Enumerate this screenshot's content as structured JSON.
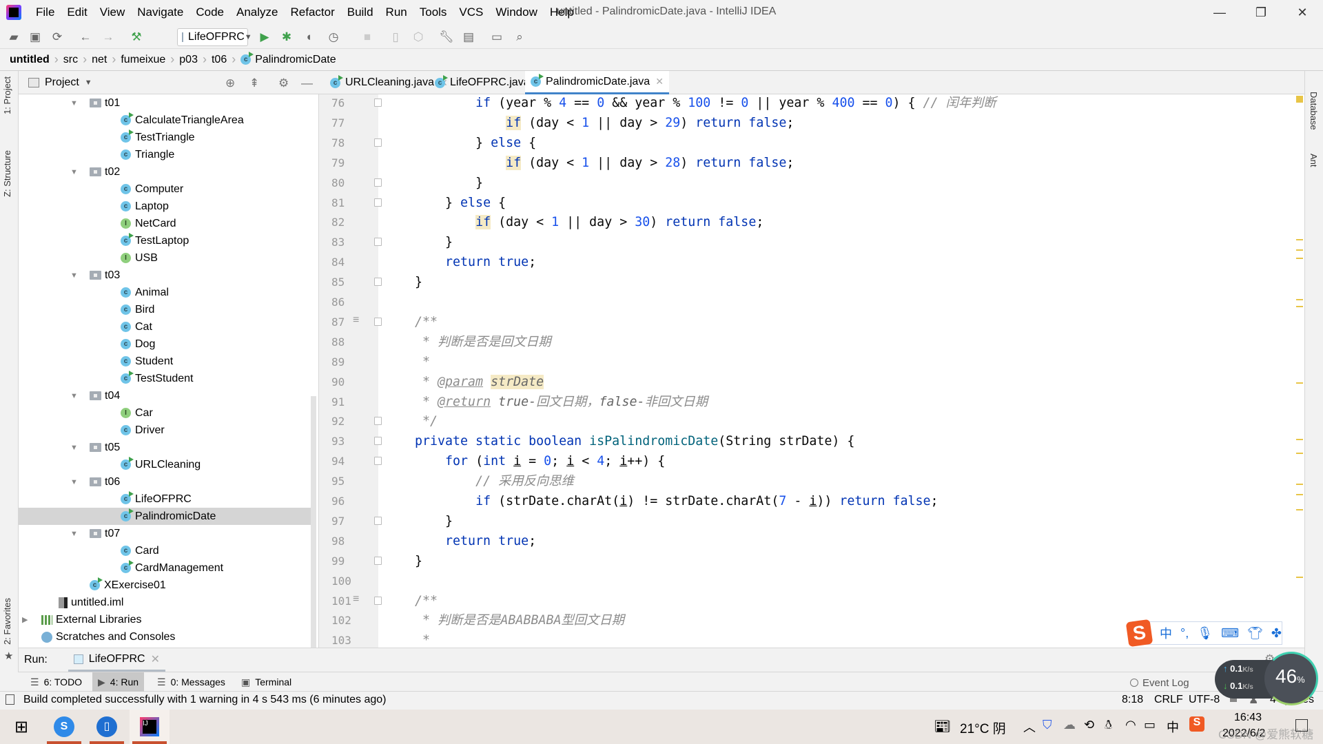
{
  "window": {
    "title": "untitled - PalindromicDate.java - IntelliJ IDEA",
    "minimize": "—",
    "restore": "❐",
    "close": "✕"
  },
  "menu": [
    "File",
    "Edit",
    "View",
    "Navigate",
    "Code",
    "Analyze",
    "Refactor",
    "Build",
    "Run",
    "Tools",
    "VCS",
    "Window",
    "Help"
  ],
  "toolbar": {
    "run_config": "LifeOFPRC",
    "icons": [
      "open-icon",
      "save-icon",
      "sync-icon",
      "back-icon",
      "forward-icon",
      "build-hammer-icon",
      "run-icon",
      "debug-icon",
      "coverage-icon",
      "profile-icon",
      "stop-icon",
      "device-icon",
      "sdk-icon",
      "settings-wrench-icon",
      "project-structure-icon",
      "terminal-icon",
      "search-icon"
    ]
  },
  "breadcrumb": [
    "untitled",
    "src",
    "net",
    "fumeixue",
    "p03",
    "t06",
    "PalindromicDate"
  ],
  "left_strip": {
    "project": "1: Project",
    "structure": "Z: Structure",
    "favorites": "2: Favorites"
  },
  "right_strip": {
    "database": "Database",
    "ant": "Ant"
  },
  "project_panel": {
    "title": "Project",
    "tree": [
      {
        "label": "t01",
        "type": "package",
        "level": 3,
        "expanded": true
      },
      {
        "label": "CalculateTriangleArea",
        "type": "class-run",
        "level": 4
      },
      {
        "label": "TestTriangle",
        "type": "class-run",
        "level": 4
      },
      {
        "label": "Triangle",
        "type": "class",
        "level": 4
      },
      {
        "label": "t02",
        "type": "package",
        "level": 3,
        "expanded": true
      },
      {
        "label": "Computer",
        "type": "class",
        "level": 4
      },
      {
        "label": "Laptop",
        "type": "class",
        "level": 4
      },
      {
        "label": "NetCard",
        "type": "interface",
        "level": 4
      },
      {
        "label": "TestLaptop",
        "type": "class-run",
        "level": 4
      },
      {
        "label": "USB",
        "type": "interface",
        "level": 4
      },
      {
        "label": "t03",
        "type": "package",
        "level": 3,
        "expanded": true
      },
      {
        "label": "Animal",
        "type": "class",
        "level": 4
      },
      {
        "label": "Bird",
        "type": "class",
        "level": 4
      },
      {
        "label": "Cat",
        "type": "class",
        "level": 4
      },
      {
        "label": "Dog",
        "type": "class",
        "level": 4
      },
      {
        "label": "Student",
        "type": "class",
        "level": 4
      },
      {
        "label": "TestStudent",
        "type": "class-run",
        "level": 4
      },
      {
        "label": "t04",
        "type": "package",
        "level": 3,
        "expanded": true
      },
      {
        "label": "Car",
        "type": "interface",
        "level": 4
      },
      {
        "label": "Driver",
        "type": "class",
        "level": 4
      },
      {
        "label": "t05",
        "type": "package",
        "level": 3,
        "expanded": true
      },
      {
        "label": "URLCleaning",
        "type": "class-run",
        "level": 4
      },
      {
        "label": "t06",
        "type": "package",
        "level": 3,
        "expanded": true
      },
      {
        "label": "LifeOFPRC",
        "type": "class-run",
        "level": 4
      },
      {
        "label": "PalindromicDate",
        "type": "class-run",
        "level": 4,
        "selected": true
      },
      {
        "label": "t07",
        "type": "package",
        "level": 3,
        "expanded": true
      },
      {
        "label": "Card",
        "type": "class",
        "level": 4
      },
      {
        "label": "CardManagement",
        "type": "class-run",
        "level": 4
      },
      {
        "label": "XExercise01",
        "type": "class-run",
        "level": 3
      },
      {
        "label": "untitled.iml",
        "type": "iml",
        "level": 2
      },
      {
        "label": "External Libraries",
        "type": "library",
        "level": 1,
        "expanded": false
      },
      {
        "label": "Scratches and Consoles",
        "type": "scratch",
        "level": 1
      }
    ]
  },
  "tabs": [
    {
      "label": "URLCleaning.java",
      "active": false
    },
    {
      "label": "LifeOFPRC.java",
      "active": false
    },
    {
      "label": "PalindromicDate.java",
      "active": true
    }
  ],
  "code": [
    {
      "n": 76,
      "fold": "start",
      "t": [
        [
          "txt",
          "        "
        ],
        [
          "kw",
          "if"
        ],
        [
          "txt",
          " (year % "
        ],
        [
          "num",
          "4"
        ],
        [
          "txt",
          " == "
        ],
        [
          "num",
          "0"
        ],
        [
          "txt",
          " && year % "
        ],
        [
          "num",
          "100"
        ],
        [
          "txt",
          " != "
        ],
        [
          "num",
          "0"
        ],
        [
          "txt",
          " || year % "
        ],
        [
          "num",
          "400"
        ],
        [
          "txt",
          " == "
        ],
        [
          "num",
          "0"
        ],
        [
          "txt",
          ") { "
        ],
        [
          "cm",
          "// 闰年判断"
        ]
      ]
    },
    {
      "n": 77,
      "t": [
        [
          "txt",
          "            "
        ],
        [
          "kw hl",
          "if"
        ],
        [
          "txt",
          " (day < "
        ],
        [
          "num",
          "1"
        ],
        [
          "txt",
          " || day > "
        ],
        [
          "num",
          "29"
        ],
        [
          "txt",
          ") "
        ],
        [
          "kw",
          "return false"
        ],
        [
          "txt",
          ";"
        ]
      ]
    },
    {
      "n": 78,
      "fold": "end",
      "t": [
        [
          "txt",
          "        } "
        ],
        [
          "kw",
          "else"
        ],
        [
          "txt",
          " {"
        ]
      ]
    },
    {
      "n": 79,
      "t": [
        [
          "txt",
          "            "
        ],
        [
          "kw hl",
          "if"
        ],
        [
          "txt",
          " (day < "
        ],
        [
          "num",
          "1"
        ],
        [
          "txt",
          " || day > "
        ],
        [
          "num",
          "28"
        ],
        [
          "txt",
          ") "
        ],
        [
          "kw",
          "return false"
        ],
        [
          "txt",
          ";"
        ]
      ]
    },
    {
      "n": 80,
      "fold": "end",
      "t": [
        [
          "txt",
          "        }"
        ]
      ]
    },
    {
      "n": 81,
      "fold": "start",
      "t": [
        [
          "txt",
          "    } "
        ],
        [
          "kw",
          "else"
        ],
        [
          "txt",
          " {"
        ]
      ]
    },
    {
      "n": 82,
      "t": [
        [
          "txt",
          "        "
        ],
        [
          "kw hl",
          "if"
        ],
        [
          "txt",
          " (day < "
        ],
        [
          "num",
          "1"
        ],
        [
          "txt",
          " || day > "
        ],
        [
          "num",
          "30"
        ],
        [
          "txt",
          ") "
        ],
        [
          "kw",
          "return false"
        ],
        [
          "txt",
          ";"
        ]
      ]
    },
    {
      "n": 83,
      "fold": "end",
      "t": [
        [
          "txt",
          "    }"
        ]
      ]
    },
    {
      "n": 84,
      "t": [
        [
          "txt",
          "    "
        ],
        [
          "kw",
          "return true"
        ],
        [
          "txt",
          ";"
        ]
      ]
    },
    {
      "n": 85,
      "fold": "end",
      "t": [
        [
          "txt",
          "}"
        ]
      ]
    },
    {
      "n": 86,
      "t": []
    },
    {
      "n": 87,
      "fold": "start",
      "doc": true,
      "t": [
        [
          "cm",
          "/**"
        ]
      ]
    },
    {
      "n": 88,
      "t": [
        [
          "cm",
          " * 判断是否是回文日期"
        ]
      ]
    },
    {
      "n": 89,
      "t": [
        [
          "cm",
          " *"
        ]
      ]
    },
    {
      "n": 90,
      "t": [
        [
          "cm",
          " * "
        ],
        [
          "tag",
          "@param"
        ],
        [
          "txt",
          " "
        ],
        [
          "doc hl",
          "strDate"
        ]
      ]
    },
    {
      "n": 91,
      "t": [
        [
          "cm",
          " * "
        ],
        [
          "tag",
          "@return"
        ],
        [
          "doc",
          " true-"
        ],
        [
          "cm",
          "回文日期，"
        ],
        [
          "doc",
          "false-"
        ],
        [
          "cm",
          "非回文日期"
        ]
      ]
    },
    {
      "n": 92,
      "fold": "end",
      "t": [
        [
          "cm",
          " */"
        ]
      ]
    },
    {
      "n": 93,
      "fold": "start",
      "t": [
        [
          "kw",
          "private static boolean "
        ],
        [
          "fn",
          "isPalindromicDate"
        ],
        [
          "txt",
          "(String strDate) {"
        ]
      ]
    },
    {
      "n": 94,
      "fold": "start",
      "t": [
        [
          "txt",
          "    "
        ],
        [
          "kw",
          "for"
        ],
        [
          "txt",
          " ("
        ],
        [
          "kw",
          "int "
        ],
        [
          "ul",
          "i"
        ],
        [
          "txt",
          " = "
        ],
        [
          "num",
          "0"
        ],
        [
          "txt",
          "; "
        ],
        [
          "ul",
          "i"
        ],
        [
          "txt",
          " < "
        ],
        [
          "num",
          "4"
        ],
        [
          "txt",
          "; "
        ],
        [
          "ul",
          "i"
        ],
        [
          "txt",
          "++) {"
        ]
      ]
    },
    {
      "n": 95,
      "t": [
        [
          "txt",
          "        "
        ],
        [
          "cm",
          "// 采用反向思维"
        ]
      ]
    },
    {
      "n": 96,
      "t": [
        [
          "txt",
          "        "
        ],
        [
          "kw",
          "if"
        ],
        [
          "txt",
          " (strDate.charAt("
        ],
        [
          "ul",
          "i"
        ],
        [
          "txt",
          ") != strDate.charAt("
        ],
        [
          "num",
          "7"
        ],
        [
          "txt",
          " - "
        ],
        [
          "ul",
          "i"
        ],
        [
          "txt",
          ")) "
        ],
        [
          "kw",
          "return false"
        ],
        [
          "txt",
          ";"
        ]
      ]
    },
    {
      "n": 97,
      "fold": "end",
      "t": [
        [
          "txt",
          "    }"
        ]
      ]
    },
    {
      "n": 98,
      "t": [
        [
          "txt",
          "    "
        ],
        [
          "kw",
          "return true"
        ],
        [
          "txt",
          ";"
        ]
      ]
    },
    {
      "n": 99,
      "fold": "end",
      "t": [
        [
          "txt",
          "}"
        ]
      ]
    },
    {
      "n": 100,
      "t": []
    },
    {
      "n": 101,
      "fold": "start",
      "doc": true,
      "t": [
        [
          "cm",
          "/**"
        ]
      ]
    },
    {
      "n": 102,
      "t": [
        [
          "cm",
          " * 判断是否是ABABBABA型回文日期"
        ]
      ]
    },
    {
      "n": 103,
      "t": [
        [
          "cm",
          " *"
        ]
      ]
    }
  ],
  "run_bar": {
    "label": "Run:",
    "tab": "LifeOFPRC"
  },
  "tool_windows": [
    {
      "label": "6: TODO",
      "icon": "list-icon"
    },
    {
      "label": "4: Run",
      "icon": "run-icon",
      "active": true
    },
    {
      "label": "0: Messages",
      "icon": "messages-icon"
    },
    {
      "label": "Terminal",
      "icon": "terminal-icon"
    }
  ],
  "status": {
    "message": "Build completed successfully with 1 warning in 4 s 543 ms (6 minutes ago)",
    "position": "8:18",
    "line_sep": "CRLF",
    "encoding": "UTF-8",
    "indent": "4 spaces",
    "event_log": "Event Log"
  },
  "ime": {
    "mode": "中",
    "punct": "°,"
  },
  "net_widget": {
    "up": "0.1",
    "down": "0.1",
    "unit": "K/s",
    "cpu": "46",
    "cpu_unit": "%"
  },
  "taskbar": {
    "weather": "21°C 阴",
    "time": "16:43",
    "date": "2022/6/2",
    "tray_lang": "中",
    "watermark": "CSDN @爱熊软糖"
  },
  "colors": {
    "keyword": "#0033b3",
    "number": "#1750eb",
    "comment": "#8c8c8c",
    "method": "#00627a",
    "highlight": "#f5eac5",
    "accent": "#4083c9"
  }
}
